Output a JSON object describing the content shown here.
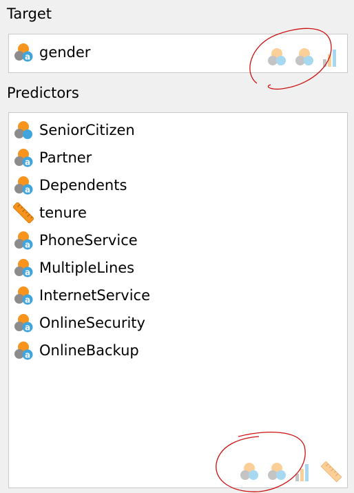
{
  "target": {
    "section_label": "Target",
    "field": {
      "label": "gender",
      "icon": "nominal-string-field-icon"
    },
    "measure_toggles": [
      "nominal-measure-icon",
      "ordinal-measure-icon",
      "ordinal-bar-measure-icon"
    ]
  },
  "predictors": {
    "section_label": "Predictors",
    "fields": [
      {
        "label": "SeniorCitizen",
        "icon": "nominal-numeric-field-icon"
      },
      {
        "label": "Partner",
        "icon": "nominal-string-field-icon"
      },
      {
        "label": "Dependents",
        "icon": "nominal-string-field-icon"
      },
      {
        "label": "tenure",
        "icon": "scale-ruler-field-icon"
      },
      {
        "label": "PhoneService",
        "icon": "nominal-string-field-icon"
      },
      {
        "label": "MultipleLines",
        "icon": "nominal-string-field-icon"
      },
      {
        "label": "InternetService",
        "icon": "nominal-string-field-icon"
      },
      {
        "label": "OnlineSecurity",
        "icon": "nominal-string-field-icon"
      },
      {
        "label": "OnlineBackup",
        "icon": "nominal-string-field-icon"
      }
    ],
    "measure_toggles": [
      "nominal-measure-icon",
      "ordinal-measure-icon",
      "ordinal-bar-measure-icon",
      "scale-ruler-measure-icon"
    ]
  },
  "colors": {
    "orange": "#f7941d",
    "gray": "#8c8c8c",
    "blue": "#3fa5dc",
    "annotation_red": "#cc1010",
    "panel_bg": "#f0f0f0",
    "list_bg": "#ffffff",
    "border": "#c9c9c9"
  }
}
